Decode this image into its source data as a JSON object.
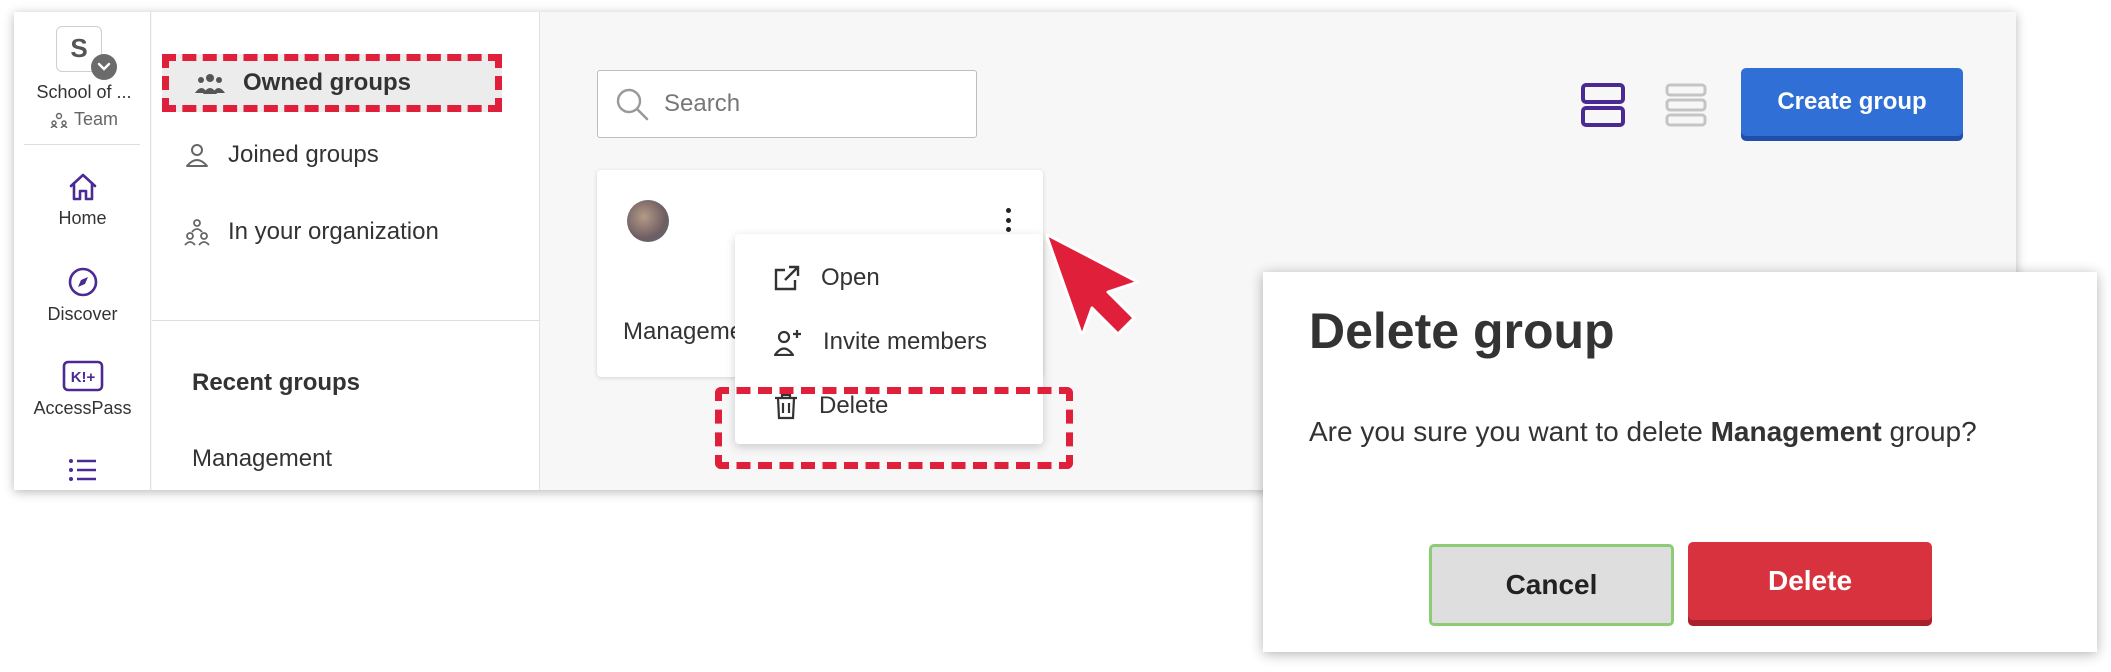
{
  "rail": {
    "org_initial": "S",
    "org_name": "School of ...",
    "org_type": "Team",
    "items": [
      {
        "label": "Home",
        "icon": "home-icon"
      },
      {
        "label": "Discover",
        "icon": "compass-icon"
      },
      {
        "label": "AccessPass",
        "icon": "accesspass-icon"
      },
      {
        "label": "",
        "icon": "list-icon"
      }
    ],
    "accent": "#4b2a93"
  },
  "groups_nav": {
    "items": [
      {
        "label": "Owned groups",
        "icon": "people-icon",
        "active": true
      },
      {
        "label": "Joined groups",
        "icon": "person-icon"
      },
      {
        "label": "In your organization",
        "icon": "organization-icon"
      }
    ],
    "recent_title": "Recent groups",
    "recent_items": [
      "Management"
    ]
  },
  "search": {
    "placeholder": "Search"
  },
  "create_label": "Create group",
  "card": {
    "name": "Management"
  },
  "menu": {
    "items": [
      {
        "label": "Open",
        "icon": "external-link-icon"
      },
      {
        "label": "Invite members",
        "icon": "add-person-icon"
      },
      {
        "label": "Delete",
        "icon": "trash-icon"
      }
    ]
  },
  "dialog": {
    "title": "Delete group",
    "message_prefix": "Are you sure you want to delete ",
    "message_bold": "Management",
    "message_suffix": " group?",
    "cancel_label": "Cancel",
    "delete_label": "Delete"
  },
  "colors": {
    "highlight": "#e0203a",
    "primary": "#2f6fd6",
    "danger": "#d9323f"
  }
}
